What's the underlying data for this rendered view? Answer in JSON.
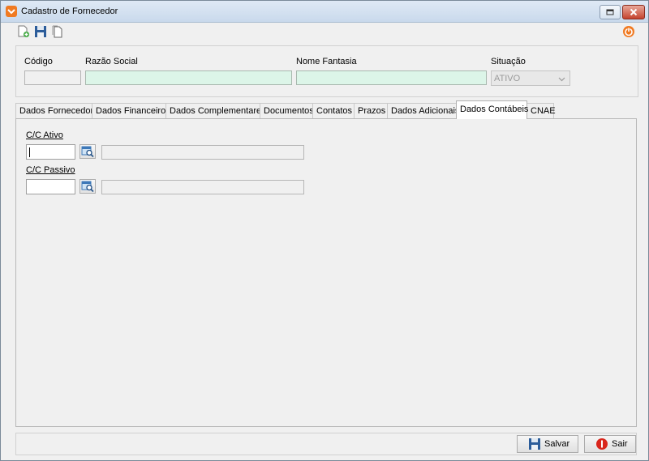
{
  "window": {
    "title": "Cadastro de Fornecedor"
  },
  "icons": {
    "app": "orange-app-icon",
    "new": "new-document-icon",
    "save": "floppy-disk-icon",
    "copy": "copy-document-icon",
    "power": "power-icon",
    "lookup": "search-lookup-icon"
  },
  "header": {
    "codigo_label": "Código",
    "codigo_value": "",
    "razao_label": "Razão Social",
    "razao_value": "",
    "fantasia_label": "Nome Fantasia",
    "fantasia_value": "",
    "situacao_label": "Situação",
    "situacao_value": "ATIVO"
  },
  "tabs": [
    {
      "label": "Dados Fornecedor"
    },
    {
      "label": "Dados Financeiros"
    },
    {
      "label": "Dados Complementares"
    },
    {
      "label": "Documentos"
    },
    {
      "label": "Contatos"
    },
    {
      "label": "Prazos"
    },
    {
      "label": "Dados Adicionais"
    },
    {
      "label": "Dados Contábeis",
      "active": true
    },
    {
      "label": "CNAE"
    }
  ],
  "contabeis": {
    "ativo_label": "C/C Ativo",
    "ativo_code": "",
    "ativo_desc": "",
    "passivo_label": "C/C Passivo",
    "passivo_code": "",
    "passivo_desc": ""
  },
  "actions": {
    "save_label": "Salvar",
    "exit_label": "Sair"
  },
  "colors": {
    "accent": "#f07a22",
    "field_green": "#dcf5e8",
    "close_red": "#c5432e"
  }
}
